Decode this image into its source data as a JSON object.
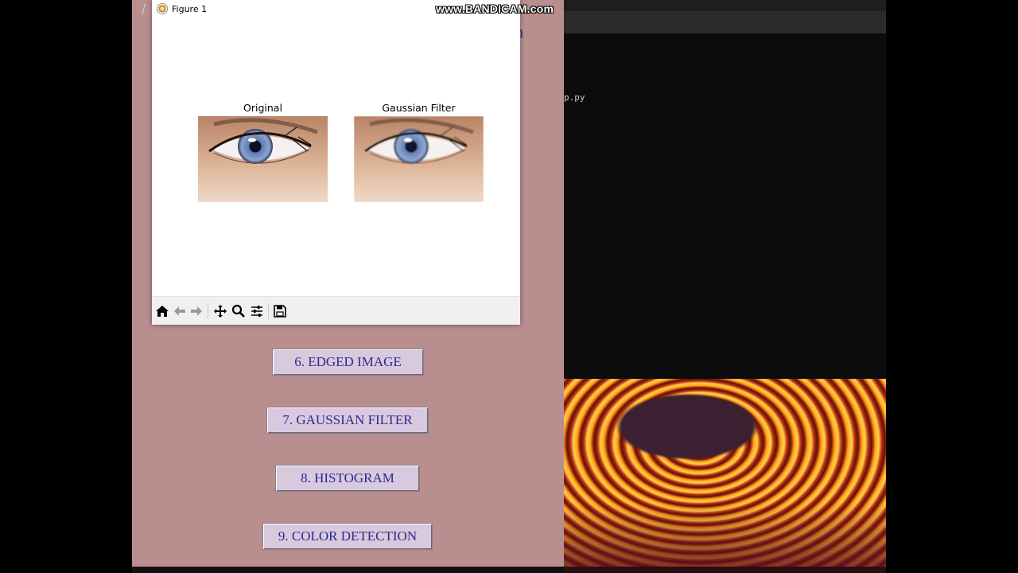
{
  "watermark": "www.BANDICAM.com",
  "app": {
    "title_fragment": "n",
    "buttons": [
      {
        "label": "6. EDGED IMAGE"
      },
      {
        "label": "7. GAUSSIAN FILTER"
      },
      {
        "label": "8. HISTOGRAM"
      },
      {
        "label": "9. COLOR DETECTION"
      }
    ],
    "colors": {
      "background": "#b98e8f",
      "button": "#d9c9de",
      "button_text": "#2b2a8c"
    }
  },
  "terminal": {
    "visible_text": "p.py"
  },
  "figure": {
    "window_title": "Figure 1",
    "subplots": [
      {
        "title": "Original"
      },
      {
        "title": "Gaussian Filter"
      }
    ],
    "toolbar": [
      {
        "icon": "home-icon"
      },
      {
        "icon": "back-arrow-icon"
      },
      {
        "icon": "forward-arrow-icon"
      },
      {
        "icon": "pan-icon"
      },
      {
        "icon": "zoom-icon"
      },
      {
        "icon": "configure-subplots-icon"
      },
      {
        "icon": "save-icon"
      }
    ]
  }
}
